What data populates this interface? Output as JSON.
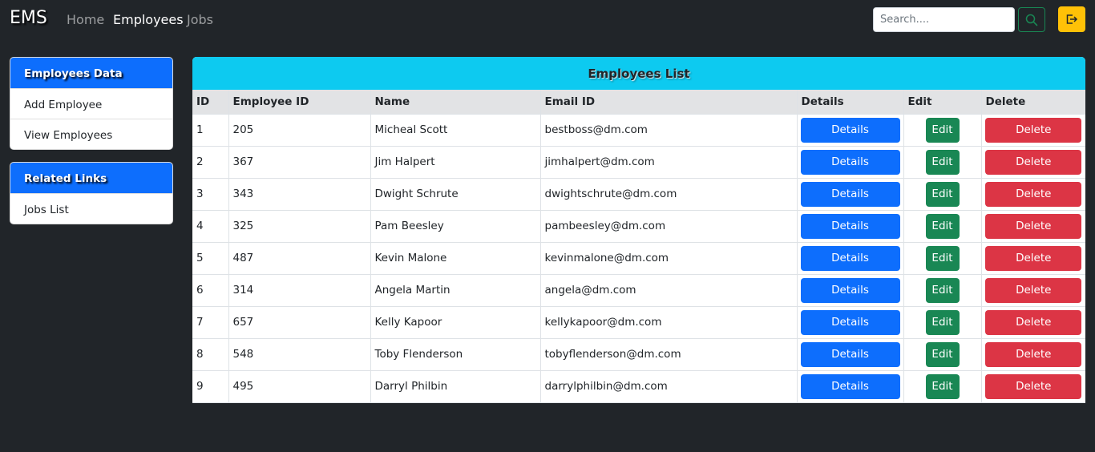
{
  "navbar": {
    "brand": "EMS",
    "links": [
      {
        "label": "Home",
        "active": false
      },
      {
        "label": "Employees",
        "active": true
      },
      {
        "label": "Jobs",
        "active": false
      }
    ],
    "search": {
      "placeholder": "Search....",
      "value": ""
    },
    "search_icon": "search-icon",
    "logout_icon": "logout-icon"
  },
  "sidebar": {
    "employees_card": {
      "title": "Employees Data",
      "items": [
        "Add Employee",
        "View Employees"
      ]
    },
    "links_card": {
      "title": "Related Links",
      "items": [
        "Jobs List"
      ]
    }
  },
  "table": {
    "title": "Employees List",
    "headers": [
      "ID",
      "Employee ID",
      "Name",
      "Email ID",
      "Details",
      "Edit",
      "Delete"
    ],
    "rows": [
      {
        "id": "1",
        "employee_id": "205",
        "name": "Micheal Scott",
        "email": "bestboss@dm.com"
      },
      {
        "id": "2",
        "employee_id": "367",
        "name": "Jim Halpert",
        "email": "jimhalpert@dm.com"
      },
      {
        "id": "3",
        "employee_id": "343",
        "name": "Dwight Schrute",
        "email": "dwightschrute@dm.com"
      },
      {
        "id": "4",
        "employee_id": "325",
        "name": "Pam Beesley",
        "email": "pambeesley@dm.com"
      },
      {
        "id": "5",
        "employee_id": "487",
        "name": "Kevin Malone",
        "email": "kevinmalone@dm.com"
      },
      {
        "id": "6",
        "employee_id": "314",
        "name": "Angela Martin",
        "email": "angela@dm.com"
      },
      {
        "id": "7",
        "employee_id": "657",
        "name": "Kelly Kapoor",
        "email": "kellykapoor@dm.com"
      },
      {
        "id": "8",
        "employee_id": "548",
        "name": "Toby Flenderson",
        "email": "tobyflenderson@dm.com"
      },
      {
        "id": "9",
        "employee_id": "495",
        "name": "Darryl Philbin",
        "email": "darrylphilbin@dm.com"
      }
    ],
    "buttons": {
      "details": "Details",
      "edit": "Edit",
      "delete": "Delete"
    }
  },
  "colors": {
    "background": "#212529",
    "primary": "#0d6efd",
    "info": "#0dcaf0",
    "success": "#198754",
    "danger": "#dc3545",
    "warning": "#ffc107"
  }
}
